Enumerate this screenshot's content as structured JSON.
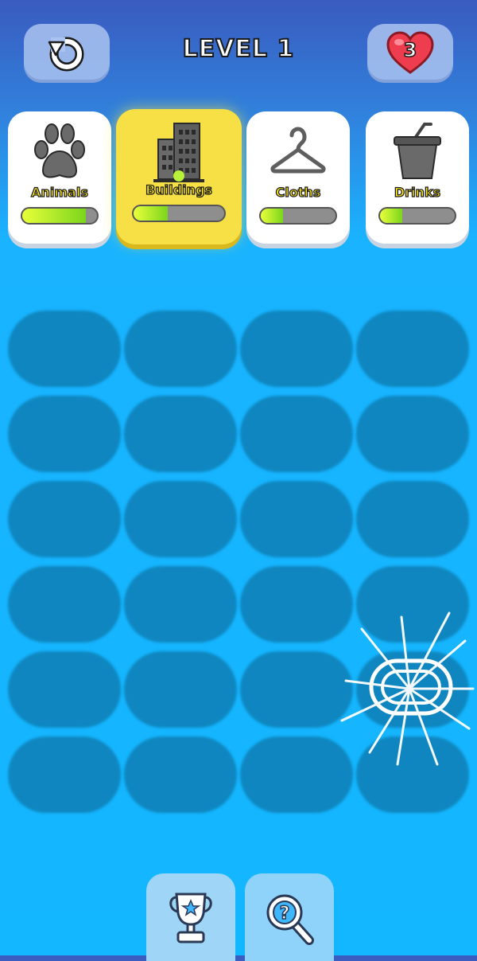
{
  "header": {
    "title": "LEVEL 1",
    "lives": "3",
    "restart_icon": "restart-icon",
    "heart_icon": "heart-icon"
  },
  "categories": [
    {
      "label": "Animals",
      "icon": "paw-icon",
      "progress": 0.85
    },
    {
      "label": "Buildings",
      "icon": "building-icon",
      "progress": 0.38,
      "active": true
    },
    {
      "label": "Cloths",
      "icon": "hanger-icon",
      "progress": 0.3
    },
    {
      "label": "Drinks",
      "icon": "cup-icon",
      "progress": 0.3
    }
  ],
  "board": {
    "rows": 6,
    "cols": 4
  },
  "bottom_bar": {
    "trophy_icon": "trophy-icon",
    "hint_icon": "magnifier-hint-icon"
  },
  "colors": {
    "active_category": "#f7e045",
    "label_text": "#ffe81a",
    "progress_fill": "#7bd61d",
    "slot": "#0f86bf"
  }
}
